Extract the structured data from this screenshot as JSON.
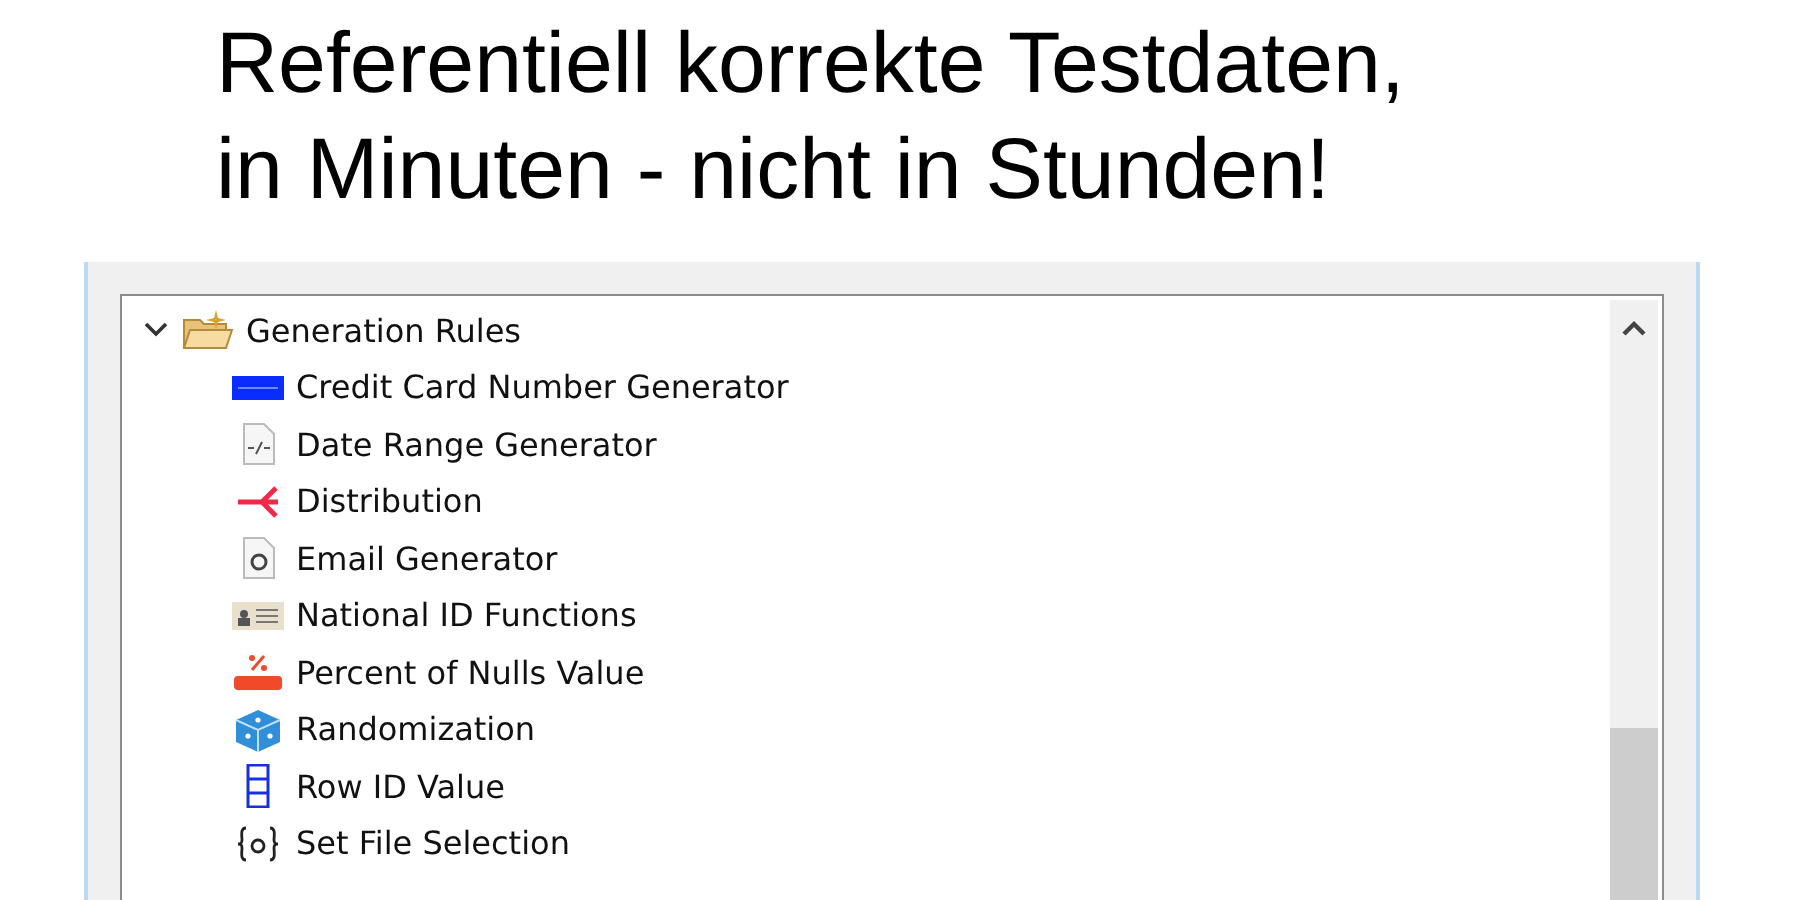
{
  "headline": [
    "Referentiell korrekte Testdaten,",
    "in Minuten - nicht in Stunden!"
  ],
  "tree": {
    "label": "Generation Rules",
    "expanded": true,
    "children": [
      {
        "label": "Credit Card Number Generator",
        "kind": "card"
      },
      {
        "label": "Date Range Generator",
        "kind": "date"
      },
      {
        "label": "Distribution",
        "kind": "fork"
      },
      {
        "label": "Email Generator",
        "kind": "email"
      },
      {
        "label": "National ID Functions",
        "kind": "id"
      },
      {
        "label": "Percent of Nulls Value",
        "kind": "nulls"
      },
      {
        "label": "Randomization",
        "kind": "dice"
      },
      {
        "label": "Row ID Value",
        "kind": "rows"
      },
      {
        "label": "Set File Selection",
        "kind": "braces"
      }
    ]
  }
}
